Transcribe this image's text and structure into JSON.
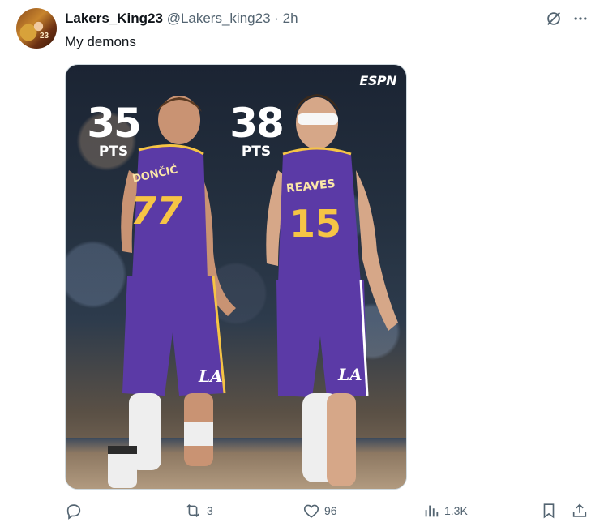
{
  "post": {
    "display_name": "Lakers_King23",
    "handle": "@Lakers_king23",
    "separator": "·",
    "time": "2h",
    "text": "My demons",
    "avatar_number": "23"
  },
  "media": {
    "brand": "ESPN",
    "left_stat": {
      "value": "35",
      "unit": "PTS"
    },
    "right_stat": {
      "value": "38",
      "unit": "PTS"
    },
    "left_player": {
      "name": "DONČIĆ",
      "number": "77"
    },
    "right_player": {
      "name": "REAVES",
      "number": "15"
    },
    "shorts_logo": "LA",
    "colors": {
      "jersey": "#5b3aa6",
      "trim": "#f6c445",
      "background": "#1f2a3a"
    }
  },
  "actions": {
    "reply_count": "",
    "repost_count": "3",
    "like_count": "96",
    "views_count": "1.3K"
  },
  "icons": {
    "grok": "grok-icon",
    "more": "more-icon",
    "reply": "reply-icon",
    "repost": "repost-icon",
    "like": "heart-icon",
    "views": "views-icon",
    "bookmark": "bookmark-icon",
    "share": "share-icon"
  }
}
